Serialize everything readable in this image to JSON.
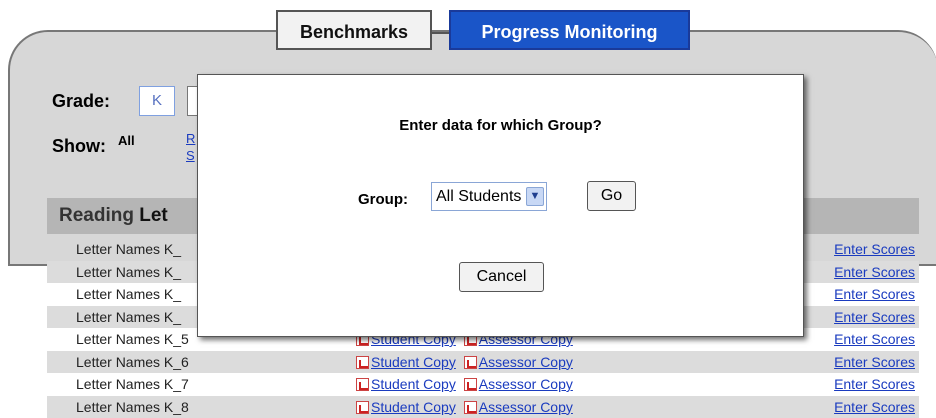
{
  "tabs": {
    "benchmarks": "Benchmarks",
    "progress_monitoring": "Progress Monitoring"
  },
  "filters": {
    "grade_label": "Grade:",
    "grade_value": "K",
    "show_label": "Show:",
    "show_all": "All",
    "show_link1": "R",
    "show_link2": "S"
  },
  "section": {
    "title_prefix": "Reading",
    "title_rest": "Let"
  },
  "rows": [
    {
      "name": "Letter Names K_",
      "student": "",
      "assessor": "",
      "enter": "Enter Scores"
    },
    {
      "name": "Letter Names K_",
      "student": "",
      "assessor": "",
      "enter": "Enter Scores"
    },
    {
      "name": "Letter Names K_",
      "student": "",
      "assessor": "",
      "enter": "Enter Scores"
    },
    {
      "name": "Letter Names K_",
      "student": "",
      "assessor": "",
      "enter": "Enter Scores"
    },
    {
      "name": "Letter Names K_5",
      "student": "Student Copy",
      "assessor": "Assessor Copy",
      "enter": "Enter Scores"
    },
    {
      "name": "Letter Names K_6",
      "student": "Student Copy",
      "assessor": "Assessor Copy",
      "enter": "Enter Scores"
    },
    {
      "name": "Letter Names K_7",
      "student": "Student Copy",
      "assessor": "Assessor Copy",
      "enter": "Enter Scores"
    },
    {
      "name": "Letter Names K_8",
      "student": "Student Copy",
      "assessor": "Assessor Copy",
      "enter": "Enter Scores"
    }
  ],
  "modal": {
    "title": "Enter data for which Group?",
    "group_label": "Group:",
    "group_selected": "All Students",
    "go_label": "Go",
    "cancel_label": "Cancel"
  },
  "colors": {
    "accent": "#1a55c8",
    "link": "#1a3bbf",
    "panel": "#d7d7d7"
  }
}
